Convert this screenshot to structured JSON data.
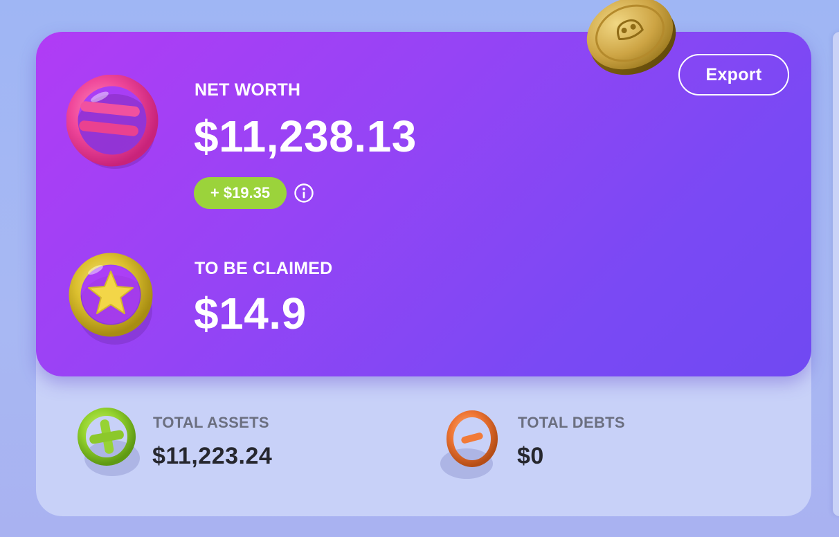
{
  "net_worth": {
    "label": "NET WORTH",
    "value": "$11,238.13",
    "change": "+ $19.35",
    "info_icon": "info-circle-icon"
  },
  "to_be_claimed": {
    "label": "TO BE CLAIMED",
    "value": "$14.9"
  },
  "export_button": {
    "label": "Export"
  },
  "total_assets": {
    "label": "TOTAL ASSETS",
    "value": "$11,223.24",
    "icon": "plus-ring-icon"
  },
  "total_debts": {
    "label": "TOTAL DEBTS",
    "value": "$0",
    "icon": "minus-ring-icon"
  },
  "icons": {
    "net_worth": "equals-ring-icon",
    "to_be_claimed": "star-ring-icon",
    "coin": "gold-coin-icon"
  },
  "colors": {
    "hero_gradient_start": "#b13cf5",
    "hero_gradient_end": "#7049f2",
    "change_badge": "#9bd33b",
    "outer_card": "#c8d1f8",
    "page_background": "#a4b5f3"
  }
}
